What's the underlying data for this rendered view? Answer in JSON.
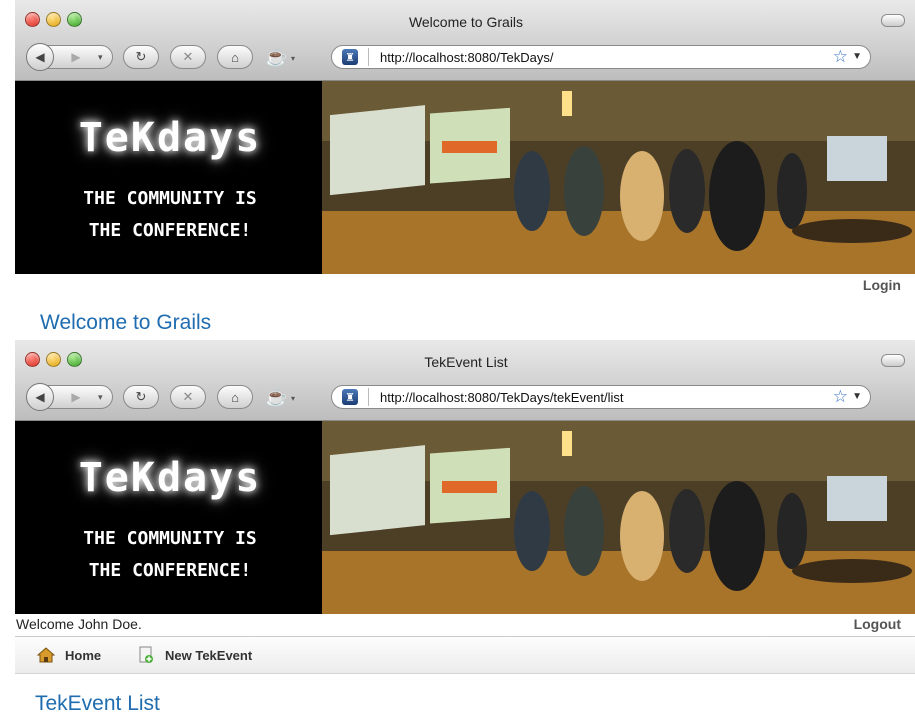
{
  "windows": [
    {
      "title": "Welcome to Grails",
      "url": "http://localhost:8080/TekDays/",
      "banner": {
        "logo": "TeKdays",
        "tagline_line1": "THE COMMUNITY IS",
        "tagline_line2": "THE CONFERENCE!"
      },
      "auth_link": "Login",
      "page_title": "Welcome to Grails"
    },
    {
      "title": "TekEvent List",
      "url": "http://localhost:8080/TekDays/tekEvent/list",
      "banner": {
        "logo": "TeKdays",
        "tagline_line1": "THE COMMUNITY IS",
        "tagline_line2": "THE CONFERENCE!"
      },
      "welcome_text": "Welcome John Doe.",
      "auth_link": "Logout",
      "nav": {
        "home": "Home",
        "new_tekevent": "New TekEvent"
      },
      "page_title": "TekEvent List"
    }
  ],
  "icons": {
    "back": "back-arrow-icon",
    "forward": "forward-arrow-icon",
    "reload": "reload-icon",
    "stop": "stop-icon",
    "home": "home-icon",
    "bookmark": "star-icon"
  },
  "colors": {
    "link_title": "#1f6cb0",
    "banner_bg": "#000000"
  }
}
